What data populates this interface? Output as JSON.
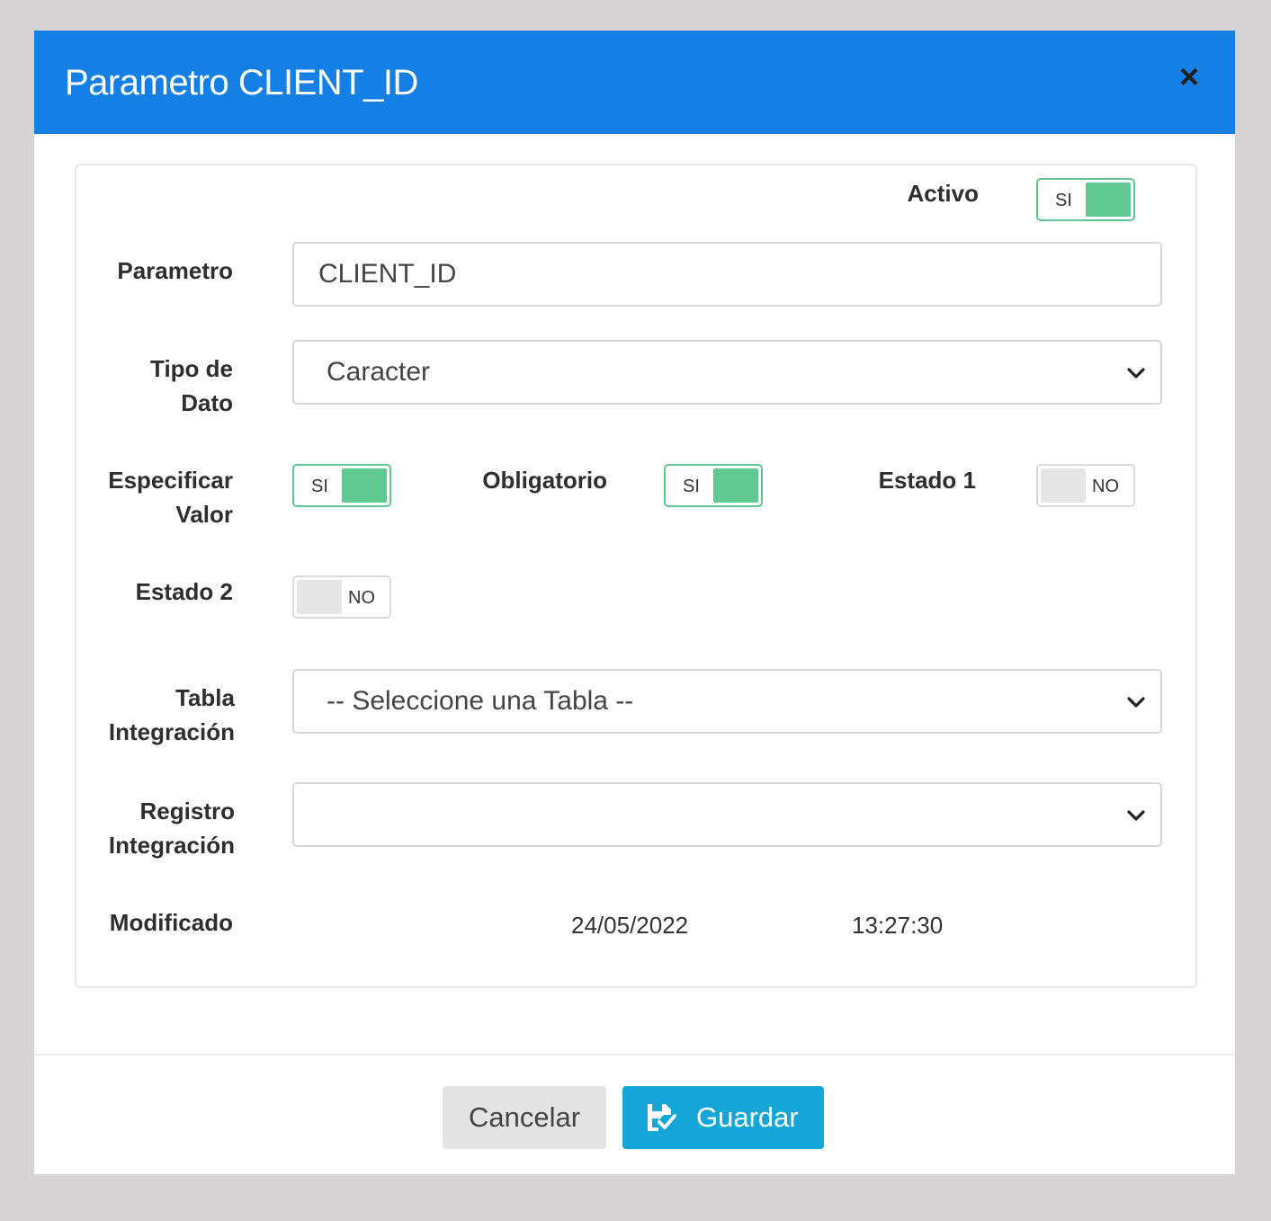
{
  "header": {
    "title": "Parametro CLIENT_ID",
    "close_label": "×"
  },
  "form": {
    "activo": {
      "label": "Activo",
      "state": "SI",
      "on": true
    },
    "parametro": {
      "label": "Parametro",
      "value": "CLIENT_ID"
    },
    "tipo_dato": {
      "label_line1": "Tipo de",
      "label_line2": "Dato",
      "selected": "Caracter"
    },
    "especificar_valor": {
      "label_line1": "Especificar",
      "label_line2": "Valor",
      "state": "SI",
      "on": true
    },
    "obligatorio": {
      "label": "Obligatorio",
      "state": "SI",
      "on": true
    },
    "estado1": {
      "label": "Estado 1",
      "state": "NO",
      "on": false
    },
    "estado2": {
      "label": "Estado 2",
      "state": "NO",
      "on": false
    },
    "tabla_integracion": {
      "label_line1": "Tabla",
      "label_line2": "Integración",
      "selected": "-- Seleccione una Tabla --"
    },
    "registro_integracion": {
      "label_line1": "Registro",
      "label_line2": "Integración",
      "selected": ""
    },
    "modificado": {
      "label": "Modificado",
      "date": "24/05/2022",
      "time": "13:27:30"
    }
  },
  "footer": {
    "cancel_label": "Cancelar",
    "save_label": "Guardar"
  },
  "colors": {
    "header_bg": "#147fe4",
    "toggle_on": "#62c892",
    "save_btn": "#13a6d6"
  },
  "icons": {
    "close": "close-icon",
    "select": "chevron-down-icon",
    "save": "save-check-icon"
  }
}
